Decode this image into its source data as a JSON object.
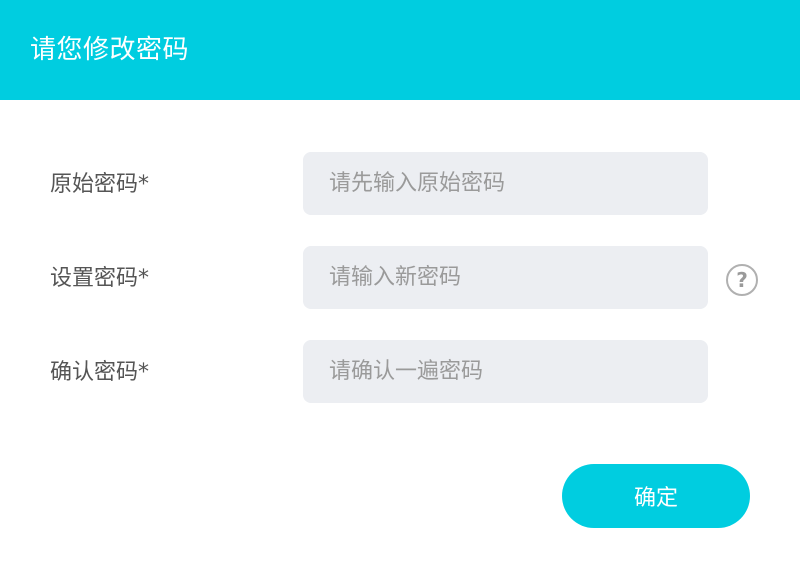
{
  "header": {
    "title": "请您修改密码"
  },
  "form": {
    "old_password": {
      "label": "原始密码*",
      "placeholder": "请先输入原始密码"
    },
    "new_password": {
      "label": "设置密码*",
      "placeholder": "请输入新密码",
      "help_icon": "question-circle-icon",
      "help_glyph": "?"
    },
    "confirm_password": {
      "label": "确认密码*",
      "placeholder": "请确认一遍密码"
    }
  },
  "actions": {
    "confirm_label": "确定"
  },
  "colors": {
    "accent": "#00cde0",
    "input_bg": "#eceef2",
    "label": "#555555",
    "placeholder": "#9a9a9a"
  }
}
